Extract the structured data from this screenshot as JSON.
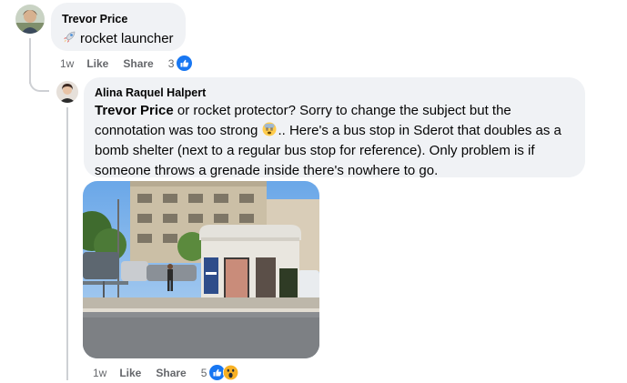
{
  "comments": [
    {
      "author": "Trevor Price",
      "text": "rocket launcher",
      "time": "1w",
      "like_label": "Like",
      "share_label": "Share",
      "reaction_count": "3",
      "reactions": [
        "like-icon"
      ]
    },
    {
      "author": "Alina Raquel Halpert",
      "mention": "Trevor Price",
      "text_part1": " or rocket protector? Sorry to change the subject but the connotation was too strong ",
      "text_part2": ".. Here's a bus stop in Sderot that doubles as a bomb shelter (next to a regular bus stop for reference). Only problem is if someone throws a grenade inside there's nowhere to go.",
      "inline_emoji": "fearful-face-emoji",
      "time": "1w",
      "like_label": "Like",
      "share_label": "Share",
      "reaction_count": "5",
      "reactions": [
        "like-icon",
        "wow-icon"
      ]
    }
  ],
  "colors": {
    "bubble": "#f0f2f5",
    "meta": "#65676b",
    "like_blue": "#1877f2",
    "thread_line": "#ced0d4"
  }
}
